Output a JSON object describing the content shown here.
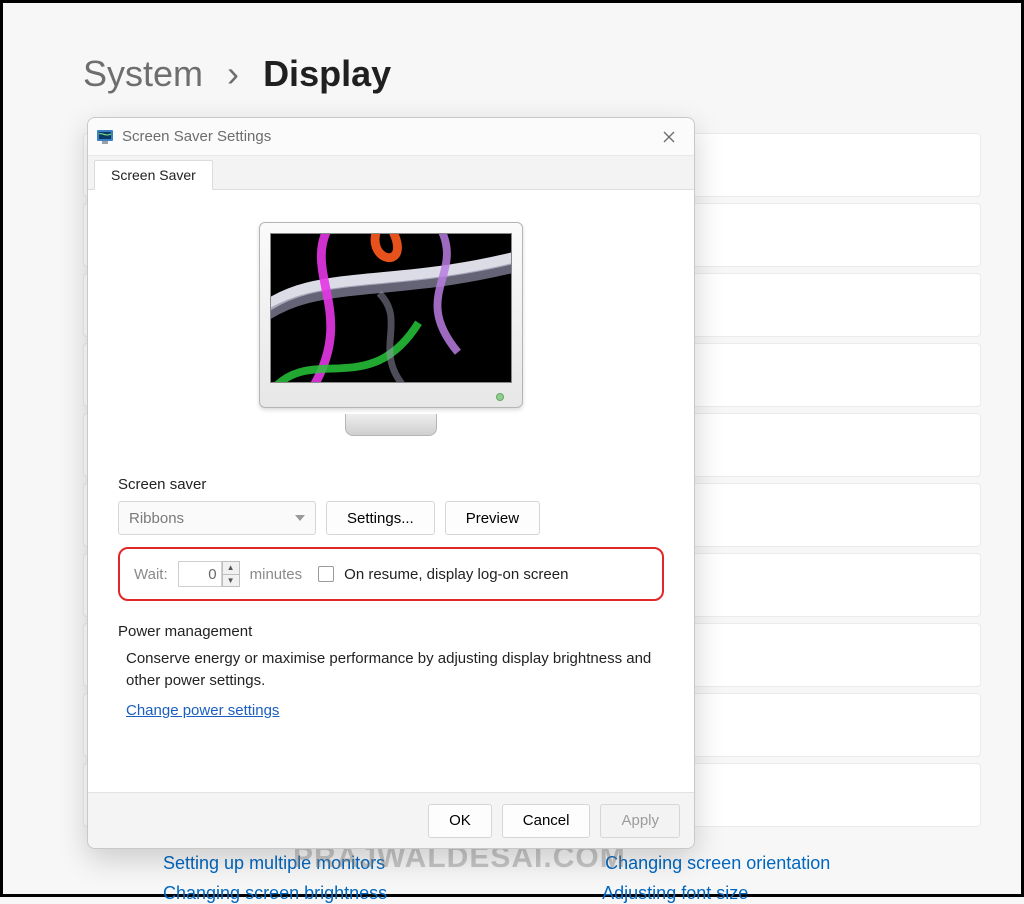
{
  "breadcrumb": {
    "parent": "System",
    "current": "Display"
  },
  "watermark": "PRAJWALDESAI.COM",
  "bg_links": {
    "a": "Setting up multiple monitors",
    "b": "Changing screen orientation",
    "c": "Changing screen brightness",
    "d": "Adjusting font size"
  },
  "dialog": {
    "title": "Screen Saver Settings",
    "tab": "Screen Saver",
    "group_label": "Screen saver",
    "combo_value": "Ribbons",
    "settings_btn": "Settings...",
    "preview_btn": "Preview",
    "wait_label": "Wait:",
    "wait_value": "0",
    "minutes_label": "minutes",
    "resume_label": "On resume, display log-on screen",
    "pm_header": "Power management",
    "pm_desc": "Conserve energy or maximise performance by adjusting display brightness and other power settings.",
    "pm_link": "Change power settings",
    "ok": "OK",
    "cancel": "Cancel",
    "apply": "Apply"
  }
}
